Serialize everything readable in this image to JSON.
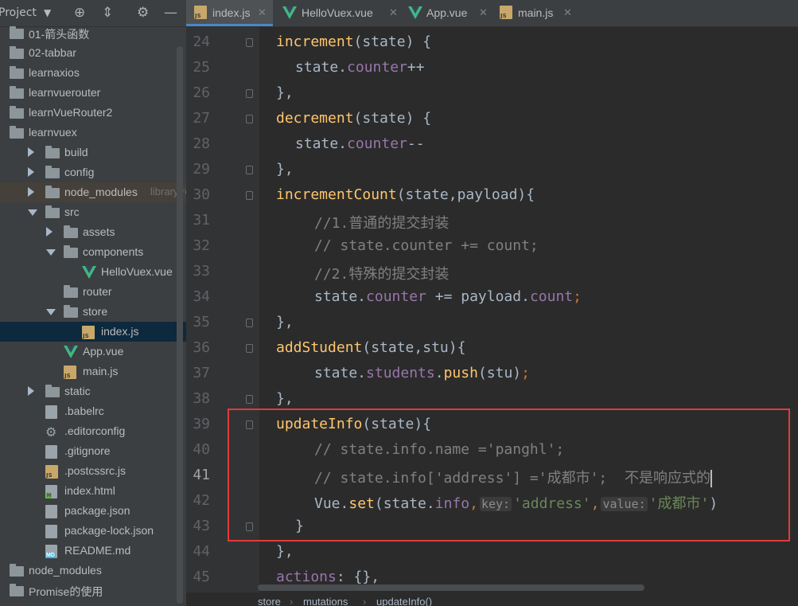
{
  "project_panel": {
    "title": "Project",
    "tree": [
      {
        "label": "01-箭头函数",
        "type": "folder"
      },
      {
        "label": "02-tabbar",
        "type": "folder"
      },
      {
        "label": "learnaxios",
        "type": "folder"
      },
      {
        "label": "learnvuerouter",
        "type": "folder"
      },
      {
        "label": "learnVueRouter2",
        "type": "folder"
      },
      {
        "label": "learnvuex",
        "type": "folder"
      },
      {
        "label": "build",
        "type": "folder"
      },
      {
        "label": "config",
        "type": "folder"
      },
      {
        "label": "node_modules",
        "type": "folder",
        "hint": "library roo"
      },
      {
        "label": "src",
        "type": "folder"
      },
      {
        "label": "assets",
        "type": "folder"
      },
      {
        "label": "components",
        "type": "folder"
      },
      {
        "label": "HelloVuex.vue",
        "type": "vue"
      },
      {
        "label": "router",
        "type": "folder"
      },
      {
        "label": "store",
        "type": "folder"
      },
      {
        "label": "index.js",
        "type": "js"
      },
      {
        "label": "App.vue",
        "type": "vue"
      },
      {
        "label": "main.js",
        "type": "js"
      },
      {
        "label": "static",
        "type": "folder"
      },
      {
        "label": ".babelrc",
        "type": "config"
      },
      {
        "label": ".editorconfig",
        "type": "settings"
      },
      {
        "label": ".gitignore",
        "type": "config"
      },
      {
        "label": ".postcssrc.js",
        "type": "js"
      },
      {
        "label": "index.html",
        "type": "html"
      },
      {
        "label": "package.json",
        "type": "config"
      },
      {
        "label": "package-lock.json",
        "type": "config"
      },
      {
        "label": "README.md",
        "type": "md"
      },
      {
        "label": "node_modules",
        "type": "folder"
      },
      {
        "label": "Promise的使用",
        "type": "folder"
      }
    ]
  },
  "tabs": [
    {
      "label": "index.js",
      "icon": "js-file-icon",
      "active": true
    },
    {
      "label": "HelloVuex.vue",
      "icon": "vue-file-icon"
    },
    {
      "label": "App.vue",
      "icon": "vue-file-icon"
    },
    {
      "label": "main.js",
      "icon": "js-file-icon"
    }
  ],
  "editor": {
    "lines": [
      {
        "n": "24"
      },
      {
        "n": "25"
      },
      {
        "n": "26"
      },
      {
        "n": "27"
      },
      {
        "n": "28"
      },
      {
        "n": "29"
      },
      {
        "n": "30"
      },
      {
        "n": "31"
      },
      {
        "n": "32"
      },
      {
        "n": "33"
      },
      {
        "n": "34"
      },
      {
        "n": "35"
      },
      {
        "n": "36"
      },
      {
        "n": "37"
      },
      {
        "n": "38"
      },
      {
        "n": "39"
      },
      {
        "n": "40"
      },
      {
        "n": "41"
      },
      {
        "n": "42"
      },
      {
        "n": "43"
      },
      {
        "n": "44"
      },
      {
        "n": "45"
      }
    ],
    "code": {
      "l24": {
        "fn": "increment",
        "rest": "(state) {"
      },
      "l25": {
        "obj": "state.",
        "prop": "counter",
        "rest": "++"
      },
      "l26": {
        "text": "},"
      },
      "l27": {
        "fn": "decrement",
        "rest": "(state) {"
      },
      "l28": {
        "obj": "state.",
        "prop": "counter",
        "rest": "--"
      },
      "l29": {
        "text": "},"
      },
      "l30": {
        "fn": "incrementCount",
        "rest": "(state,payload){"
      },
      "l31": {
        "comment": "//1.普通的提交封装"
      },
      "l32": {
        "comment": "// state.counter += count;"
      },
      "l33": {
        "comment": "//2.特殊的提交封装"
      },
      "l34": {
        "obj": "state.",
        "prop": "counter",
        "rest": " += payload.",
        "prop2": "count",
        "end": ";"
      },
      "l35": {
        "text": "},"
      },
      "l36": {
        "fn": "addStudent",
        "rest": "(state,stu){"
      },
      "l37": {
        "obj": "state.",
        "prop": "students",
        "mid": ".",
        "fn": "push",
        "rest": "(stu)",
        "end": ";"
      },
      "l38": {
        "text": "},"
      },
      "l39": {
        "fn": "updateInfo",
        "rest": "(state){"
      },
      "l40": {
        "comment": "// state.info.name ='panghl';"
      },
      "l41": {
        "comment": "// state.info['address'] ='成都市';  不是响应式的"
      },
      "l42": {
        "obj": "Vue.",
        "fn": "set",
        "open": "(state.",
        "prop": "info",
        "comma": ",",
        "hint_key": "key:",
        "str1": "'address'",
        "comma2": ",",
        "hint_value": "value:",
        "str2": "'成都市'",
        "close": ")"
      },
      "l43": {
        "text": "}"
      },
      "l44": {
        "text": "},"
      },
      "l45": {
        "prop": "actions",
        "rest": ": {},"
      }
    },
    "current_line": "41"
  },
  "breadcrumbs": [
    "store",
    "mutations",
    "updateInfo()"
  ]
}
